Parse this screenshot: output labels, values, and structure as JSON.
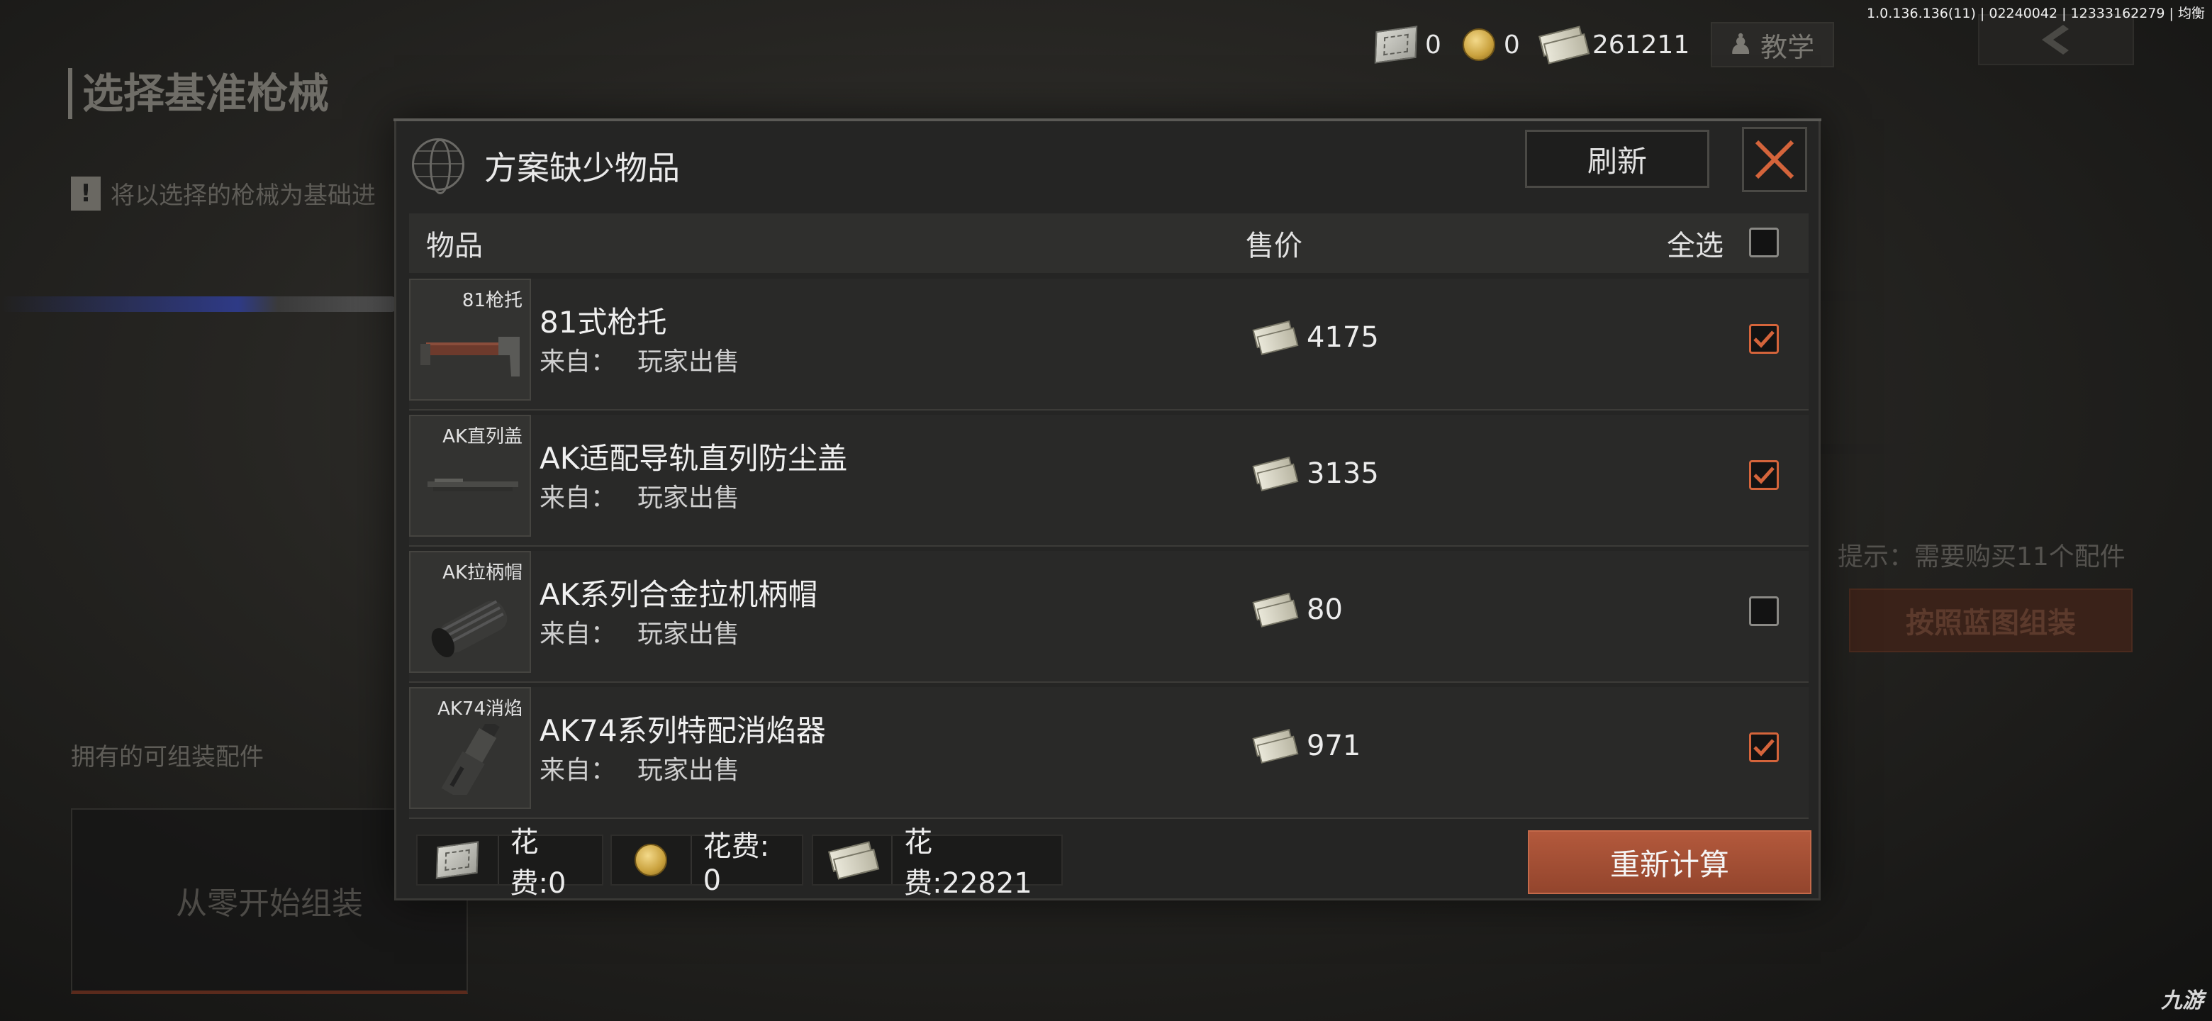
{
  "version": "1.0.136.136(11) | 02240042 | 12333162279 | 均衡",
  "background": {
    "title": "选择基准枪械",
    "notice": "将以选择的枪械为基础进",
    "owned_label": "拥有的可组装配件",
    "start_from_scratch": "从零开始组装",
    "hint": "提示：需要购买11个配件",
    "assemble_by_blueprint": "按照蓝图组装"
  },
  "currency": [
    {
      "icon": "ticket-icon",
      "amount": "0"
    },
    {
      "icon": "coin-icon",
      "amount": "0"
    },
    {
      "icon": "cash-icon",
      "amount": "261211"
    }
  ],
  "tutorial_label": "教学",
  "modal": {
    "title": "方案缺少物品",
    "refresh_label": "刷新",
    "columns": {
      "item": "物品",
      "price": "售价",
      "select_all": "全选"
    },
    "select_all_checked": false,
    "source_prefix": "来自：",
    "items": [
      {
        "thumb_label": "81枪托",
        "name": "81式枪托",
        "source": "玩家出售",
        "price": "4175",
        "checked": true,
        "icon": "stock-icon"
      },
      {
        "thumb_label": "AK直列盖",
        "name": "AK适配导轨直列防尘盖",
        "source": "玩家出售",
        "price": "3135",
        "checked": true,
        "icon": "rail-cover-icon"
      },
      {
        "thumb_label": "AK拉柄帽",
        "name": "AK系列合金拉机柄帽",
        "source": "玩家出售",
        "price": "80",
        "checked": false,
        "icon": "charging-handle-icon"
      },
      {
        "thumb_label": "AK74消焰",
        "name": "AK74系列特配消焰器",
        "source": "玩家出售",
        "price": "971",
        "checked": true,
        "icon": "flash-hider-icon"
      }
    ],
    "costs": [
      {
        "icon": "ticket-icon",
        "label": "花费:0"
      },
      {
        "icon": "coin-icon",
        "label": "花费: 0"
      },
      {
        "icon": "cash-icon",
        "label": "花费:22821"
      }
    ],
    "recalculate_label": "重新计算"
  },
  "watermark": "九游",
  "colors": {
    "accent": "#d4643b",
    "button_primary": "#a3503a",
    "panel": "#252524"
  }
}
